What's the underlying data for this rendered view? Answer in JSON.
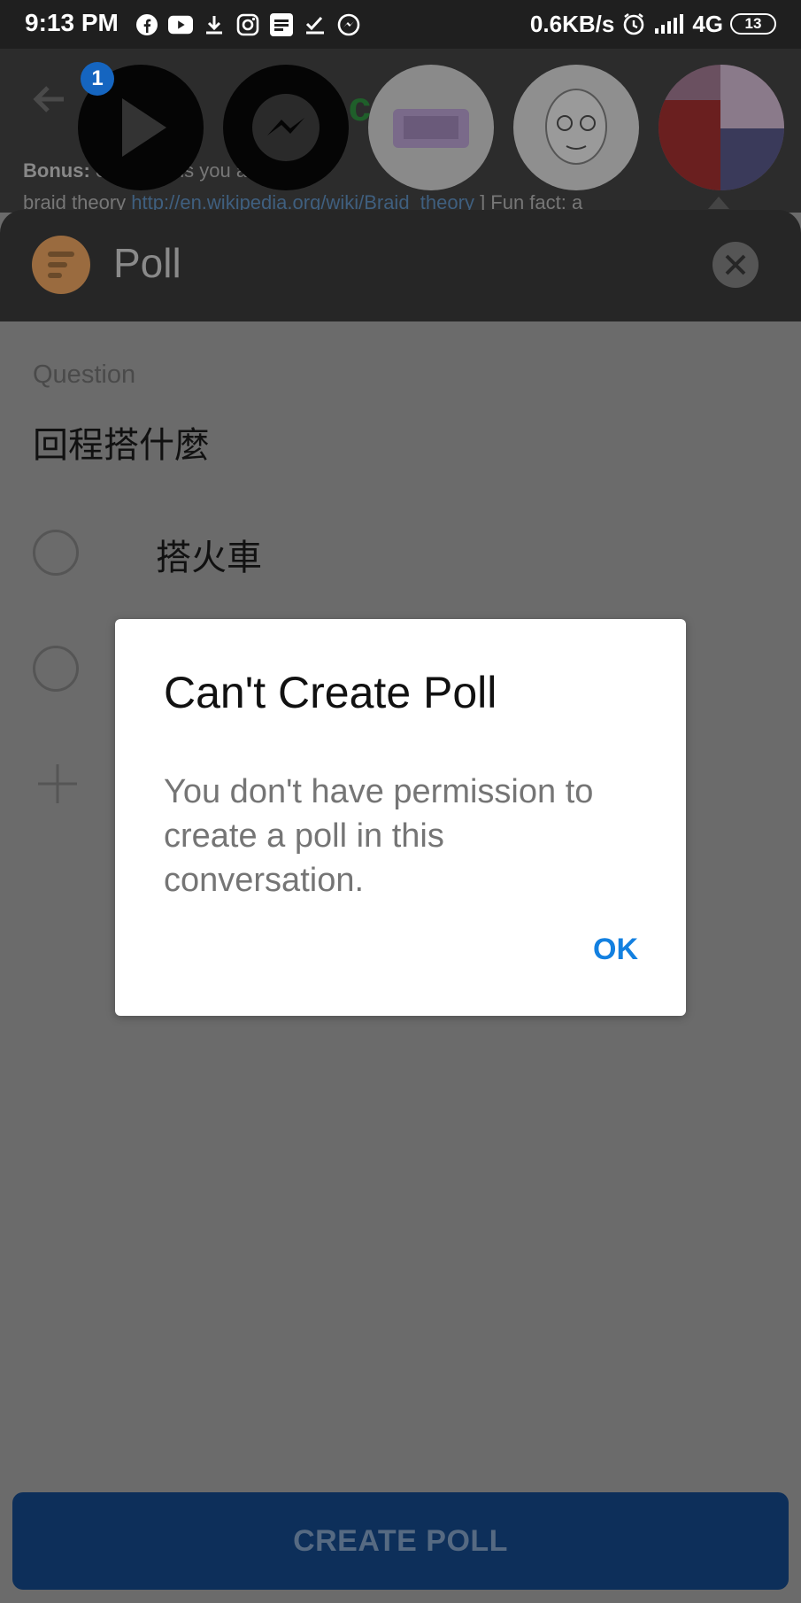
{
  "status_bar": {
    "time": "9:13 PM",
    "net_speed": "0.6KB/s",
    "network": "4G",
    "battery": "13",
    "icons": [
      "facebook-icon",
      "youtube-icon",
      "download-icon",
      "instagram-icon",
      "app-icon",
      "check-icon",
      "messenger-icon",
      "alarm-icon",
      "signal-icon"
    ]
  },
  "conversation": {
    "bonus_label": "Bonus:",
    "bonus_rest": " e inte   y this       you     about",
    "braid_prefix": "braid theory ",
    "braid_link": "http://en.wikipedia.org/wiki/Braid_theory",
    "braid_suffix": " ] Fun fact: a"
  },
  "chat_heads": {
    "badge": "1"
  },
  "poll": {
    "header_title": "Poll",
    "question_label": "Question",
    "question_value": "回程搭什麼",
    "options": [
      "搭火車"
    ],
    "create_button": "CREATE POLL"
  },
  "dialog": {
    "title": "Can't Create Poll",
    "message": "You don't have permission to create a poll in this conversation.",
    "ok": "OK"
  },
  "colors": {
    "accent": "#1380e0",
    "create_button_bg": "#0d2f5a",
    "scrim": "#6b6b6b"
  }
}
